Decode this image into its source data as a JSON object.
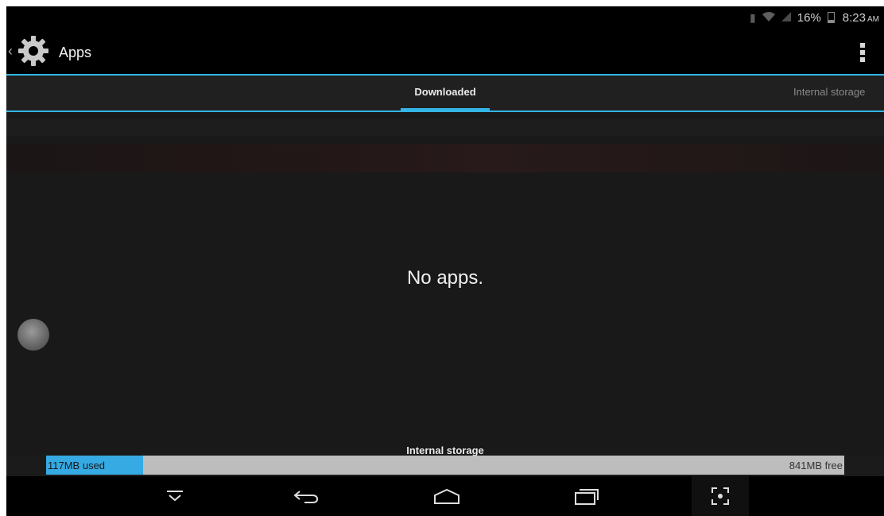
{
  "status_bar": {
    "battery_percent": "16%",
    "time": "8:23",
    "ampm": "AM"
  },
  "action_bar": {
    "title": "Apps"
  },
  "tabs": [
    {
      "label": "Downloaded",
      "selected": true
    },
    {
      "label": "Internal storage",
      "selected": false
    }
  ],
  "content": {
    "empty_message": "No apps."
  },
  "storage": {
    "label": "Internal storage",
    "used": "117MB used",
    "free": "841MB free",
    "used_fraction": 0.122
  },
  "colors": {
    "accent": "#33b5e5",
    "used_bar": "#35aae3",
    "free_bar": "#bdbdbd"
  },
  "icons": {
    "up": "chevron-left-icon",
    "settings": "gear-icon",
    "menu": "overflow-menu-icon",
    "nav": [
      "hide-keyboard-icon",
      "back-icon",
      "home-icon",
      "recent-apps-icon",
      "screenshot-icon"
    ]
  }
}
